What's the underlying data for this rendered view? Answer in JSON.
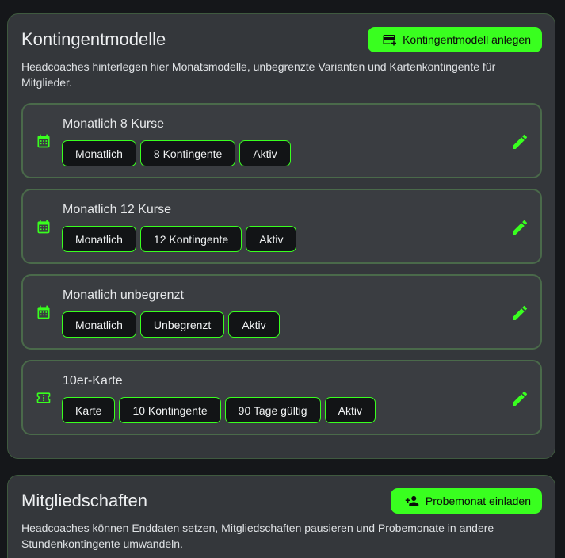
{
  "colors": {
    "accent": "#39ff1f",
    "card_bg": "#34373b",
    "item_bg": "#3a3d41",
    "chip_bg": "#121416",
    "page_bg": "#15171a"
  },
  "models_section": {
    "title": "Kontingentmodelle",
    "add_button_label": "Kontingentmodell anlegen",
    "add_button_icon": "card-plus-icon",
    "description": "Headcoaches hinterlegen hier Monatsmodelle, unbegrenzte Varianten und Kartenkontingente für Mitglieder.",
    "items": [
      {
        "name": "Monatlich 8 Kurse",
        "icon": "calendar-icon",
        "chips": [
          "Monatlich",
          "8 Kontingente",
          "Aktiv"
        ],
        "edit_icon": "pencil-icon"
      },
      {
        "name": "Monatlich 12 Kurse",
        "icon": "calendar-icon",
        "chips": [
          "Monatlich",
          "12 Kontingente",
          "Aktiv"
        ],
        "edit_icon": "pencil-icon"
      },
      {
        "name": "Monatlich unbegrenzt",
        "icon": "calendar-icon",
        "chips": [
          "Monatlich",
          "Unbegrenzt",
          "Aktiv"
        ],
        "edit_icon": "pencil-icon"
      },
      {
        "name": "10er-Karte",
        "icon": "ticket-icon",
        "chips": [
          "Karte",
          "10 Kontingente",
          "90 Tage gültig",
          "Aktiv"
        ],
        "edit_icon": "pencil-icon"
      }
    ]
  },
  "members_section": {
    "title": "Mitgliedschaften",
    "invite_button_label": "Probemonat einladen",
    "invite_button_icon": "person-add-icon",
    "description": "Headcoaches können Enddaten setzen, Mitgliedschaften pausieren und Probemonate in andere Stundenkontingente umwandeln."
  }
}
